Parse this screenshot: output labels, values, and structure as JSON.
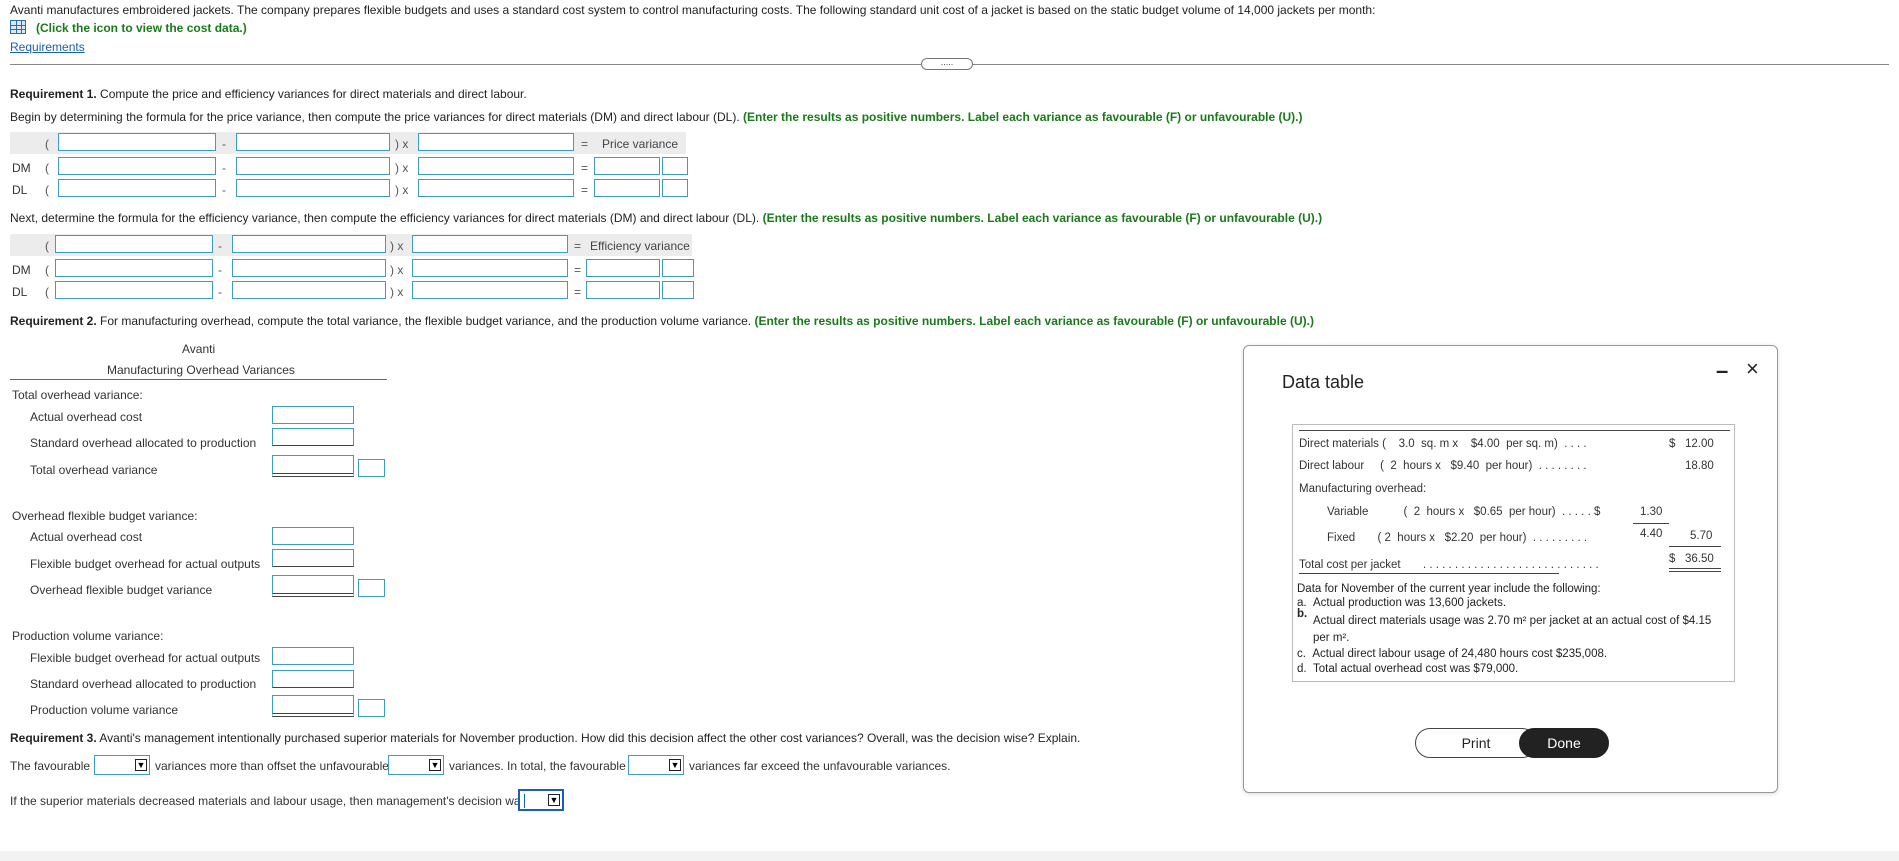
{
  "intro": "Avanti manufactures embroidered jackets. The company prepares flexible budgets and uses a standard cost system to control manufacturing costs. The following standard unit cost of a jacket is based on the static budget volume of 14,000 jackets per month:",
  "data_link": "(Click the icon to view the cost data.)",
  "requirements_link": "Requirements",
  "handle": ".....",
  "req1": {
    "label": "Requirement 1.",
    "text": "Compute the price and efficiency variances for direct materials and direct labour.",
    "price_intro": "Begin by determining the formula for the price variance, then compute the price variances for direct materials (DM) and direct labour (DL).",
    "instruction": "(Enter the results as positive numbers. Label each variance as favourable (F) or unfavourable (U).)",
    "price_header": "Price variance",
    "eff_intro": "Next, determine the formula for the efficiency variance, then compute the efficiency variances for direct materials (DM) and direct labour (DL).",
    "eff_header": "Efficiency variance",
    "dm": "DM",
    "dl": "DL",
    "open_paren": "(",
    "minus": "-",
    "times": ") x",
    "equals": "="
  },
  "req2": {
    "label": "Requirement 2.",
    "text": "For manufacturing overhead, compute the total variance, the flexible budget variance, and the production volume variance.",
    "company": "Avanti",
    "table_title": "Manufacturing Overhead Variances",
    "total_title": "Total overhead variance:",
    "actual_overhead": "Actual overhead cost",
    "std_allocated": "Standard overhead allocated to production",
    "total_variance": "Total overhead variance",
    "flex_title": "Overhead flexible budget variance:",
    "flex_budget_oh": "Flexible budget overhead for actual outputs",
    "flex_variance": "Overhead flexible budget variance",
    "prod_title": "Production volume variance:",
    "prod_variance": "Production volume variance"
  },
  "req3": {
    "label": "Requirement 3.",
    "text": "Avanti's management intentionally purchased superior materials for November production. How did this decision affect the other cost variances? Overall, was the decision wise? Explain.",
    "s1a": "The favourable",
    "s1b": "variances more than offset the unfavourable",
    "s1c": "variances. In total, the favourable",
    "s1d": "variances far exceed the unfavourable variances.",
    "s2a": "If the superior materials decreased materials and labour usage, then management's decision was",
    "arrow": "▼"
  },
  "modal": {
    "title": "Data table",
    "minimize": "–",
    "close": "×",
    "dm_row": "Direct materials (    3.0  sq. m x    $4.00  per sq. m)  . . . .",
    "dm_val": "$   12.00",
    "dl_row": "Direct labour     (  2  hours x   $9.40  per hour)  . . . . . . . .",
    "dl_val": "18.80",
    "moh": "Manufacturing overhead:",
    "var_row": "Variable           (  2  hours x   $0.65  per hour)  . . . . . $",
    "var_val": "1.30",
    "fix_row": "Fixed       ( 2  hours x   $2.20  per hour)  . . . . . . . . .",
    "fix_val": "4.40",
    "moh_total": "5.70",
    "total_row": "Total cost per jacket       . . . . . . . . . . . . . . . . . . . . . . . . . . . .",
    "total_val": "$   36.50",
    "nov_intro": "Data for November of the current year include the following:",
    "a": "a.  Actual production was 13,600 jackets.",
    "b_prefix": "b.",
    "b": "Actual direct materials usage was 2.70 m² per jacket at an actual cost of $4.15",
    "b2": "per m².",
    "c": "c.  Actual direct labour usage of 24,480 hours cost $235,008.",
    "d": "d.  Total actual overhead cost was $79,000.",
    "print": "Print",
    "done": "Done"
  }
}
